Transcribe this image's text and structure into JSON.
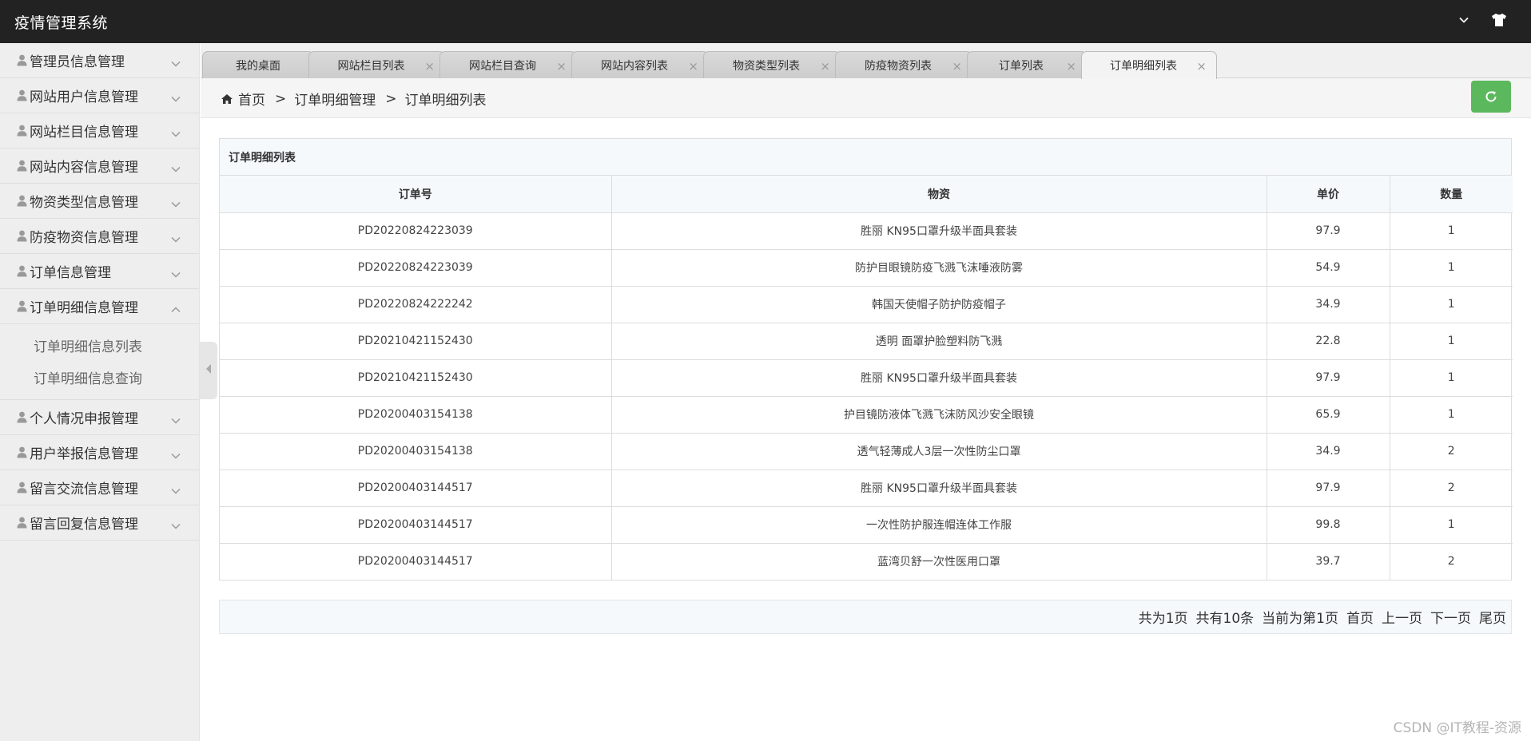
{
  "app": {
    "title": "疫情管理系统"
  },
  "sidebar": {
    "items": [
      {
        "label": "管理员信息管理"
      },
      {
        "label": "网站用户信息管理"
      },
      {
        "label": "网站栏目信息管理"
      },
      {
        "label": "网站内容信息管理"
      },
      {
        "label": "物资类型信息管理"
      },
      {
        "label": "防疫物资信息管理"
      },
      {
        "label": "订单信息管理"
      },
      {
        "label": "订单明细信息管理",
        "expanded": true
      },
      {
        "label": "个人情况申报管理"
      },
      {
        "label": "用户举报信息管理"
      },
      {
        "label": "留言交流信息管理"
      },
      {
        "label": "留言回复信息管理"
      }
    ],
    "submenu": [
      {
        "label": "订单明细信息列表"
      },
      {
        "label": "订单明细信息查询"
      }
    ]
  },
  "tabs": [
    {
      "label": "我的桌面"
    },
    {
      "label": "网站栏目列表"
    },
    {
      "label": "网站栏目查询"
    },
    {
      "label": "网站内容列表"
    },
    {
      "label": "物资类型列表"
    },
    {
      "label": "防疫物资列表"
    },
    {
      "label": "订单列表"
    },
    {
      "label": "订单明细列表",
      "active": true
    }
  ],
  "breadcrumb": {
    "home": "首页",
    "sep": ">",
    "level1": "订单明细管理",
    "level2": "订单明细列表"
  },
  "table": {
    "title": "订单明细列表",
    "headers": [
      "订单号",
      "物资",
      "单价",
      "数量"
    ],
    "rows": [
      [
        "PD20220824223039",
        "胜丽 KN95口罩升级半面具套装",
        "97.9",
        "1"
      ],
      [
        "PD20220824223039",
        "防护目眼镜防疫飞溅飞沫唾液防雾",
        "54.9",
        "1"
      ],
      [
        "PD20220824222242",
        "韩国天使帽子防护防疫帽子",
        "34.9",
        "1"
      ],
      [
        "PD20210421152430",
        "透明 面罩护脸塑料防飞溅",
        "22.8",
        "1"
      ],
      [
        "PD20210421152430",
        "胜丽 KN95口罩升级半面具套装",
        "97.9",
        "1"
      ],
      [
        "PD20200403154138",
        "护目镜防液体飞溅飞沫防风沙安全眼镜",
        "65.9",
        "1"
      ],
      [
        "PD20200403154138",
        "透气轻薄成人3层一次性防尘口罩",
        "34.9",
        "2"
      ],
      [
        "PD20200403144517",
        "胜丽 KN95口罩升级半面具套装",
        "97.9",
        "2"
      ],
      [
        "PD20200403144517",
        "一次性防护服连帽连体工作服",
        "99.8",
        "1"
      ],
      [
        "PD20200403144517",
        "蓝湾贝舒一次性医用口罩",
        "39.7",
        "2"
      ]
    ]
  },
  "pager": {
    "total_pages": "共为1页",
    "total_items": "共有10条",
    "current": "当前为第1页",
    "first": "首页",
    "prev": "上一页",
    "next": "下一页",
    "last": "尾页"
  },
  "watermark": "CSDN @IT教程-资源",
  "colors": {
    "header_bg": "#222222",
    "refresh_btn": "#5cb85c",
    "sidebar_bg": "#eeeeee"
  }
}
